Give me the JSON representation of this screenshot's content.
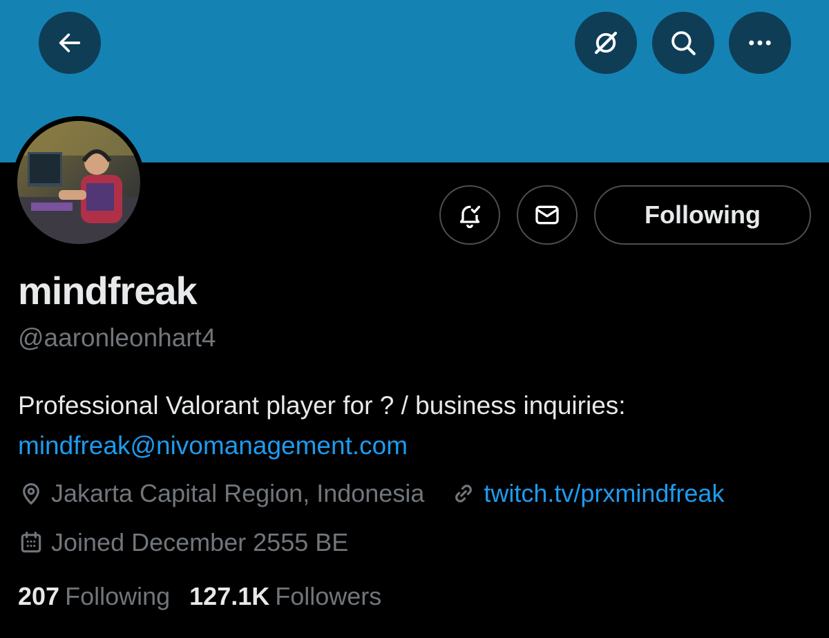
{
  "colors": {
    "banner": "#1483b4",
    "link": "#1d9bf0",
    "muted": "#71767b",
    "text": "#e7e9ea"
  },
  "topbar": {
    "back_icon": "arrow-left-icon",
    "grok_icon": "grok-icon",
    "search_icon": "search-icon",
    "more_icon": "more-horizontal-icon"
  },
  "actions": {
    "notify_icon": "bell-check-icon",
    "message_icon": "envelope-icon",
    "follow_label": "Following"
  },
  "profile": {
    "name": "mindfreak",
    "handle": "@aaronleonhart4",
    "bio_text": "Professional Valorant player for ? / business inquiries:",
    "bio_link": "mindfreak@nivomanagement.com",
    "location": "Jakarta Capital Region, Indonesia",
    "website": "twitch.tv/prxmindfreak",
    "joined": "Joined December 2555 BE"
  },
  "stats": {
    "following_count": "207",
    "following_label": "Following",
    "followers_count": "127.1K",
    "followers_label": "Followers"
  }
}
